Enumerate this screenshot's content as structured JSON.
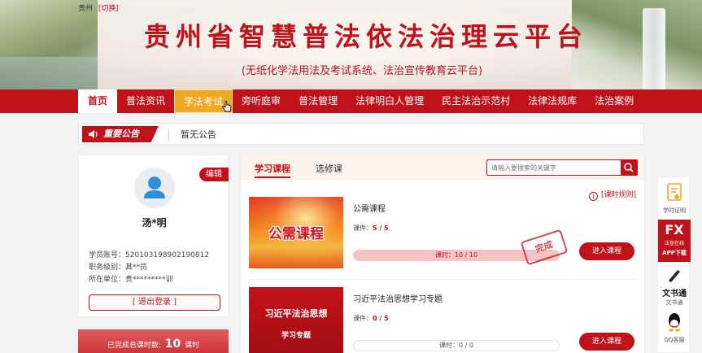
{
  "header": {
    "region": "贵州",
    "switch_label": "[切换]",
    "title": "贵州省智慧普法依法治理云平台",
    "subtitle": "(无纸化学法用法及考试系统、法治宣传教育云平台)"
  },
  "nav": {
    "items": [
      "首页",
      "普法资讯",
      "学法考试",
      "旁听庭审",
      "普法管理",
      "法律明白人管理",
      "民主法治示范村",
      "法律法规库",
      "法治案例"
    ],
    "active_index": 0,
    "hover_index": 2
  },
  "notice": {
    "badge": "重要公告",
    "text": "暂无公告"
  },
  "profile": {
    "edit_label": "编辑",
    "name": "汤*明",
    "account_label": "学员账号：",
    "account_value": "520103198902190812",
    "level_label": "职务级别：",
    "level_value": "其**员",
    "unit_label": "所在单位：",
    "unit_value": "贵*********训",
    "logout_label": "[ 退出登录 ]",
    "credit_prefix": "已完成总课时数:",
    "credit_value": "10",
    "credit_suffix": "课时"
  },
  "courses": {
    "tabs": [
      "学习课程",
      "选修课"
    ],
    "active_tab": 0,
    "search_placeholder": "请输入要搜索的关键字",
    "rules_label": "[课时规则]",
    "items": [
      {
        "thumb_text": "公需课程",
        "title": "公需课程",
        "count_label": "课件：",
        "count_value": "5 / 5",
        "progress_text": "课时：10 / 10",
        "progress": 1.0,
        "stamp": "完成",
        "button": "进入课程"
      },
      {
        "thumb_text": "习近平法治思想",
        "thumb_subtext": "学习专题",
        "title": "习近平法治思想学习专题",
        "count_label": "课件：",
        "count_value": "0 / 5",
        "progress_text": "课时：0 / 0",
        "progress": 0,
        "button": "进入课程"
      }
    ]
  },
  "floatbar": {
    "items": [
      {
        "label": "学时证明",
        "icon": "certificate-icon"
      },
      {
        "label": "法宣在线",
        "icon": "fx-logo-icon",
        "big": "FX",
        "extra": "APP下载"
      },
      {
        "label": "文书通",
        "icon": "pen-icon",
        "big": "文书通"
      },
      {
        "label": "QQ客服",
        "icon": "qq-icon"
      }
    ]
  },
  "colors": {
    "brand_red": "#c0121b",
    "nav_hover": "#f0a824",
    "notice_bg": "#ffffff"
  }
}
